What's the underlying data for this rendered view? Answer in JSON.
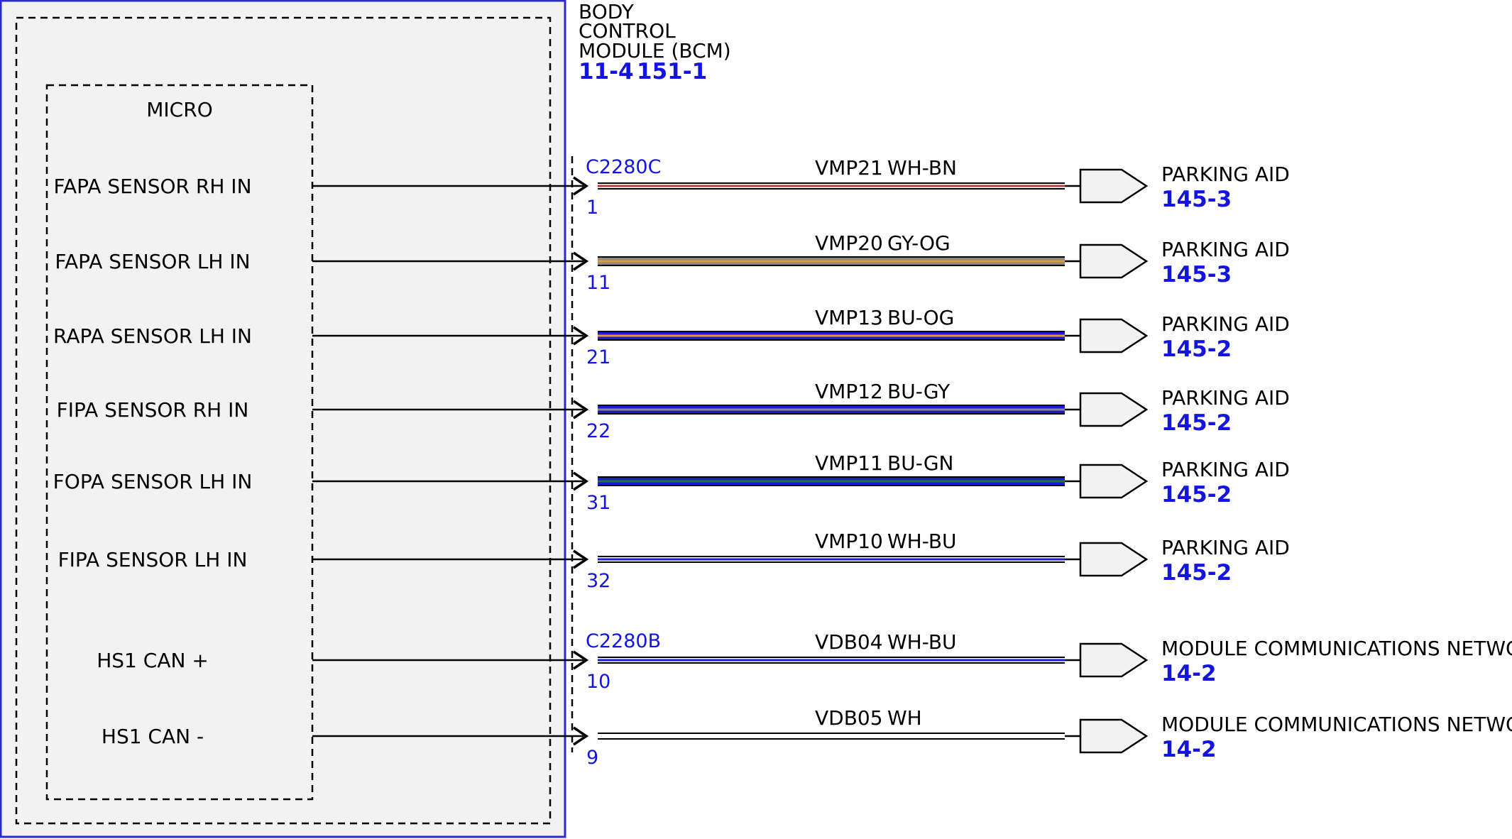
{
  "module": {
    "name_lines": [
      "BODY",
      "CONTROL",
      "MODULE (BCM)"
    ],
    "refs": [
      "11-4",
      "151-1"
    ],
    "micro_label": "MICRO"
  },
  "connectors": [
    {
      "id": "c2280c",
      "label": "C2280C"
    },
    {
      "id": "c2280b",
      "label": "C2280B"
    }
  ],
  "circuits": [
    {
      "signal": "FAPA SENSOR RH IN",
      "pin": "1",
      "circuit": "VMP21",
      "color_code": "WH-BN",
      "wire_base": "#ffffff",
      "wire_stripe": "#b04040",
      "thick": false,
      "dest": "PARKING AID",
      "dest_ref": "145-3",
      "connector": "c2280c"
    },
    {
      "signal": "FAPA SENSOR LH IN",
      "pin": "11",
      "circuit": "VMP20",
      "color_code": "GY-OG",
      "wire_base": "#8a8a8a",
      "wire_stripe": "#e39a2a",
      "thick": true,
      "dest": "PARKING AID",
      "dest_ref": "145-3",
      "connector": ""
    },
    {
      "signal": "RAPA SENSOR LH IN",
      "pin": "21",
      "circuit": "VMP13",
      "color_code": "BU-OG",
      "wire_base": "#1a1ad8",
      "wire_stripe": "#e39a2a",
      "thick": true,
      "dest": "PARKING AID",
      "dest_ref": "145-2",
      "connector": ""
    },
    {
      "signal": "FIPA SENSOR RH IN",
      "pin": "22",
      "circuit": "VMP12",
      "color_code": "BU-GY",
      "wire_base": "#1a1ad8",
      "wire_stripe": "#8a8a8a",
      "thick": true,
      "dest": "PARKING AID",
      "dest_ref": "145-2",
      "connector": ""
    },
    {
      "signal": "FOPA SENSOR LH IN",
      "pin": "31",
      "circuit": "VMP11",
      "color_code": "BU-GN",
      "wire_base": "#1a1ad8",
      "wire_stripe": "#1f7a2a",
      "thick": true,
      "dest": "PARKING AID",
      "dest_ref": "145-2",
      "connector": ""
    },
    {
      "signal": "FIPA SENSOR LH IN",
      "pin": "32",
      "circuit": "VMP10",
      "color_code": "WH-BU",
      "wire_base": "#ffffff",
      "wire_stripe": "#1a1ad8",
      "thick": false,
      "dest": "PARKING AID",
      "dest_ref": "145-2",
      "connector": ""
    },
    {
      "signal": "HS1 CAN +",
      "pin": "10",
      "circuit": "VDB04",
      "color_code": "WH-BU",
      "wire_base": "#ffffff",
      "wire_stripe": "#1a1ad8",
      "thick": false,
      "dest": "MODULE COMMUNICATIONS NETWORK",
      "dest_ref": "14-2",
      "connector": "c2280b"
    },
    {
      "signal": "HS1 CAN -",
      "pin": "9",
      "circuit": "VDB05",
      "color_code": "WH",
      "wire_base": "#ffffff",
      "wire_stripe": "#ffffff",
      "thick": false,
      "dest": "MODULE COMMUNICATIONS NETWORK",
      "dest_ref": "14-2",
      "connector": ""
    }
  ]
}
